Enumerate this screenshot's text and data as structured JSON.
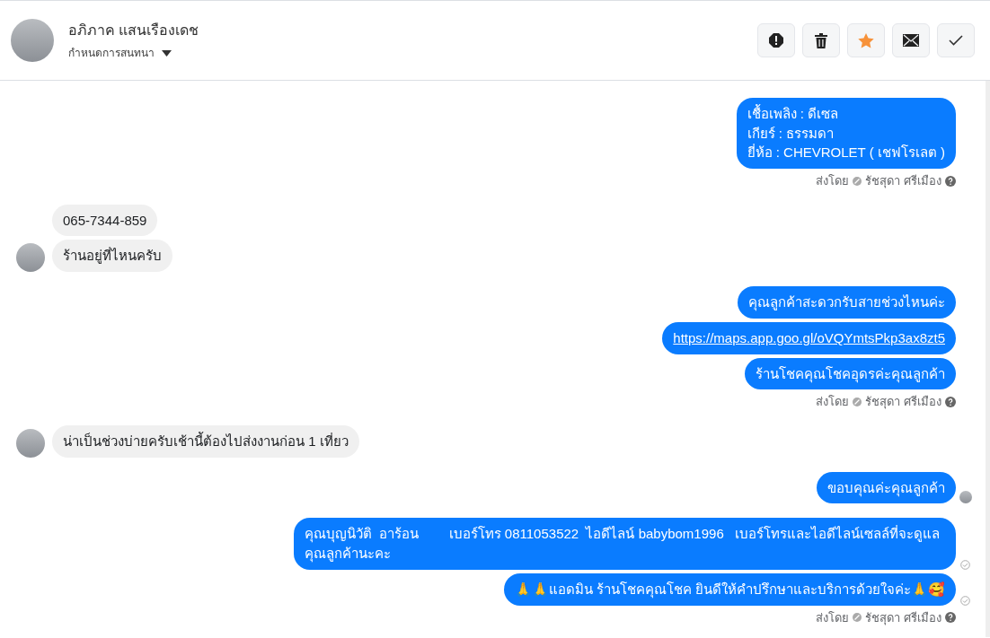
{
  "header": {
    "name": "อภิภาค แสนเรืองเดช",
    "subtitle": "กำหนดการสนทนา",
    "actions": [
      {
        "kind": "alert",
        "color": "#222222"
      },
      {
        "kind": "trash",
        "color": "#222222"
      },
      {
        "kind": "star",
        "color": "#f7923a"
      },
      {
        "kind": "mail",
        "color": "#222222"
      },
      {
        "kind": "check",
        "color": "#333333"
      }
    ]
  },
  "groups": [
    {
      "outgoing": true,
      "bubbles": [
        {
          "kind": "text",
          "lines": [
            "เชื้อเพลิง : ดีเซล",
            "เกียร์ : ธรรมดา",
            "ยี่ห้อ : CHEVROLET ( เชฟโรเลต )"
          ]
        }
      ],
      "sent_label": "ส่งโดย",
      "sender": "รัชสุดา ศรีเมือง"
    },
    {
      "outgoing": false,
      "bubbles": [
        {
          "kind": "text",
          "lines": [
            "065-7344-859"
          ]
        },
        {
          "kind": "text",
          "lines": [
            "ร้านอยู่ที่ไหนครับ"
          ]
        }
      ]
    },
    {
      "outgoing": true,
      "bubbles": [
        {
          "kind": "text",
          "lines": [
            "คุณลูกค้าสะดวกรับสายช่วงไหนค่ะ"
          ]
        },
        {
          "kind": "link",
          "lines": [
            "https://maps.app.goo.gl/oVQYmtsPkp3ax8zt5"
          ]
        },
        {
          "kind": "text",
          "lines": [
            "ร้านโชคคุณโชคอุดรค่ะคุณลูกค้า"
          ]
        }
      ],
      "sent_label": "ส่งโดย",
      "sender": "รัชสุดา ศรีเมือง"
    },
    {
      "outgoing": false,
      "bubbles": [
        {
          "kind": "text",
          "lines": [
            "น่าเป็นช่วงบ่ายครับเช้านี้ต้องไปส่งงานก่อน 1 เที่ยว"
          ]
        }
      ]
    },
    {
      "outgoing": true,
      "bubbles": [
        {
          "kind": "text",
          "lines": [
            "ขอบคุณค่ะคุณลูกค้า"
          ],
          "seen": true
        }
      ]
    },
    {
      "outgoing": true,
      "bubbles": [
        {
          "kind": "text",
          "lines": [
            "คุณบุญนิวัติ  อาร้อน        เบอร์โทร 0811053522  ไอดีไลน์ babybom1996   เบอร์โทรและไอดีไลน์เซลล์ที่จะดูแลคุณลูกค้านะคะ"
          ],
          "delivered": true
        },
        {
          "kind": "text",
          "lines": [
            "🙏🙏แอดมิน ร้านโชคคุณโชค ยินดีให้คำปรึกษาและบริการด้วยใจค่ะ🙏🥰"
          ],
          "delivered": true
        }
      ],
      "sent_label": "ส่งโดย",
      "sender": "รัชสุดา ศรีเมือง"
    }
  ]
}
